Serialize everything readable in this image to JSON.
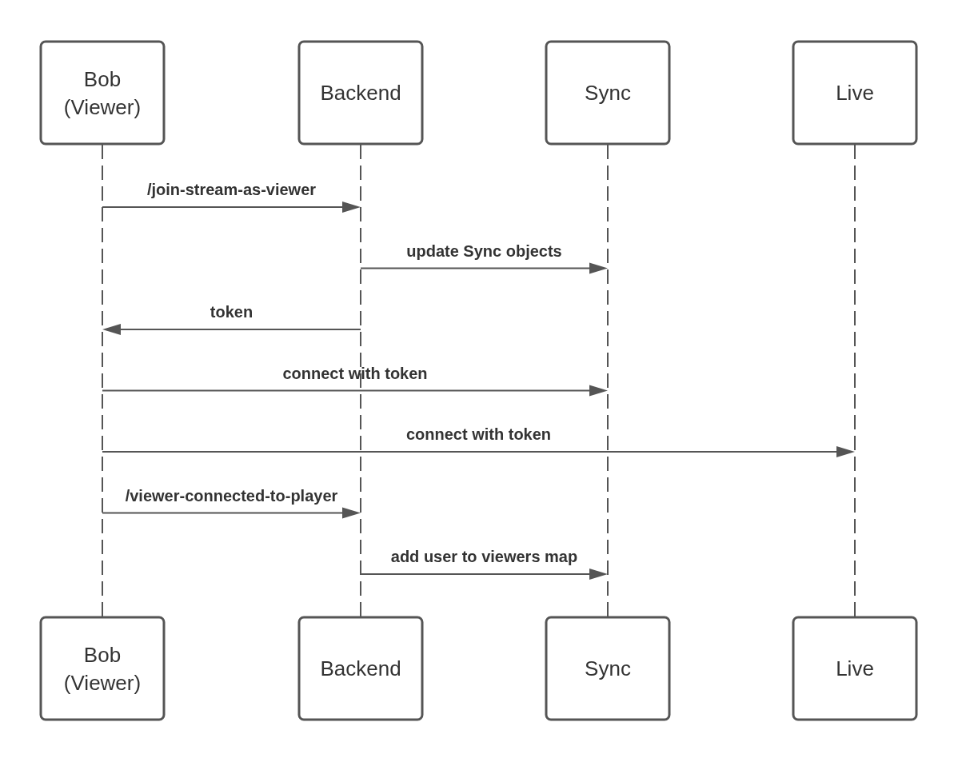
{
  "participants_top": [
    {
      "name_lines": [
        "Bob",
        "(Viewer)"
      ]
    },
    {
      "name_lines": [
        "Backend"
      ]
    },
    {
      "name_lines": [
        "Sync"
      ]
    },
    {
      "name_lines": [
        "Live"
      ]
    }
  ],
  "messages": [
    {
      "label": "/join-stream-as-viewer",
      "lanes": [
        {
          "kind": "source"
        },
        {
          "kind": "target"
        },
        {
          "kind": "none"
        },
        {
          "kind": "none"
        }
      ]
    },
    {
      "label": "update Sync objects",
      "lanes": [
        {
          "kind": "none"
        },
        {
          "kind": "source"
        },
        {
          "kind": "target"
        },
        {
          "kind": "none"
        }
      ]
    },
    {
      "label": "token",
      "lanes": [
        {
          "kind": "target"
        },
        {
          "kind": "source"
        },
        {
          "kind": "none"
        },
        {
          "kind": "none"
        }
      ]
    },
    {
      "label": "connect with token",
      "lanes": [
        {
          "kind": "source"
        },
        {
          "kind": "none"
        },
        {
          "kind": "target"
        },
        {
          "kind": "none"
        }
      ]
    },
    {
      "label": "connect with token",
      "lanes": [
        {
          "kind": "source"
        },
        {
          "kind": "none"
        },
        {
          "kind": "none"
        },
        {
          "kind": "target"
        }
      ]
    },
    {
      "label": "/viewer-connected-to-player",
      "lanes": [
        {
          "kind": "source"
        },
        {
          "kind": "target"
        },
        {
          "kind": "none"
        },
        {
          "kind": "none"
        }
      ]
    },
    {
      "label": "add user to viewers map",
      "lanes": [
        {
          "kind": "none"
        },
        {
          "kind": "source"
        },
        {
          "kind": "target"
        },
        {
          "kind": "none"
        }
      ]
    }
  ],
  "participants_bottom": [
    {
      "name_lines": [
        "Bob",
        "(Viewer)"
      ]
    },
    {
      "name_lines": [
        "Backend"
      ]
    },
    {
      "name_lines": [
        "Sync"
      ]
    },
    {
      "name_lines": [
        "Live"
      ]
    }
  ]
}
